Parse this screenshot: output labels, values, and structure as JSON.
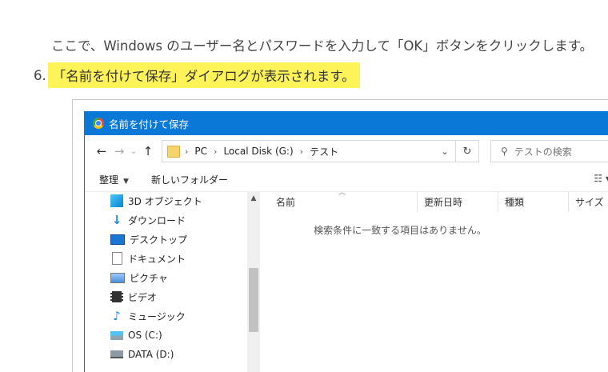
{
  "article": {
    "paragraph": "ここで、Windows のユーザー名とパスワードを入力して「OK」ボタンをクリックします。",
    "step_number": "6.",
    "step_text": "「名前を付けて保存」ダイアログが表示されます。"
  },
  "dialog": {
    "title": "名前を付けて保存",
    "path": [
      "PC",
      "Local Disk (G:)",
      "テスト"
    ],
    "search_placeholder": "テストの検索",
    "toolbar": {
      "organize": "整理",
      "new_folder": "新しいフォルダー"
    },
    "nav_items": [
      {
        "label": "3D オブジェクト",
        "icon": "3d-objects-icon"
      },
      {
        "label": "ダウンロード",
        "icon": "download-icon"
      },
      {
        "label": "デスクトップ",
        "icon": "desktop-icon"
      },
      {
        "label": "ドキュメント",
        "icon": "document-icon"
      },
      {
        "label": "ピクチャ",
        "icon": "picture-icon"
      },
      {
        "label": "ビデオ",
        "icon": "video-icon"
      },
      {
        "label": "ミュージック",
        "icon": "music-icon"
      },
      {
        "label": "OS (C:)",
        "icon": "drive-c-icon"
      },
      {
        "label": "DATA (D:)",
        "icon": "drive-d-icon"
      }
    ],
    "columns": [
      "名前",
      "更新日時",
      "種類",
      "サイズ"
    ],
    "empty_message": "検索条件に一致する項目はありません。"
  },
  "colors": {
    "titlebar": "#0a78d7",
    "highlight": "#fff35a"
  }
}
